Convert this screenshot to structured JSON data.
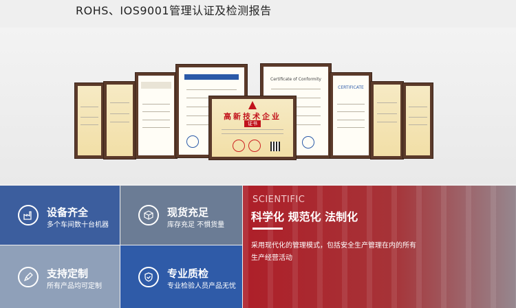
{
  "header": {
    "title": "ROHS、IOS9001管理认证及检测报告"
  },
  "certificates": {
    "center_title": "高新技术企业",
    "center_sub": "证书",
    "items": [
      {
        "label": "CERTIFICATE"
      },
      {
        "label": "Certificate of Conformity"
      }
    ]
  },
  "features": [
    {
      "title": "设备齐全",
      "desc": "多个车间数十台机器",
      "icon": "factory-icon"
    },
    {
      "title": "现货充足",
      "desc": "库存充足 不惧货量",
      "icon": "box-icon"
    },
    {
      "title": "支持定制",
      "desc": "所有产品均可定制",
      "icon": "pencil-ruler-icon"
    },
    {
      "title": "专业质检",
      "desc": "专业检验人员产品无忧",
      "icon": "shield-check-icon"
    }
  ],
  "panel": {
    "eyebrow": "SCIENTIFIC",
    "heading": "科学化 规范化 法制化",
    "body": "采用现代化的管理模式，包括安全生产管理在内的所有生产经营活动"
  },
  "colors": {
    "accent_red": "#b3141e",
    "blue": "#2f5ba8"
  }
}
